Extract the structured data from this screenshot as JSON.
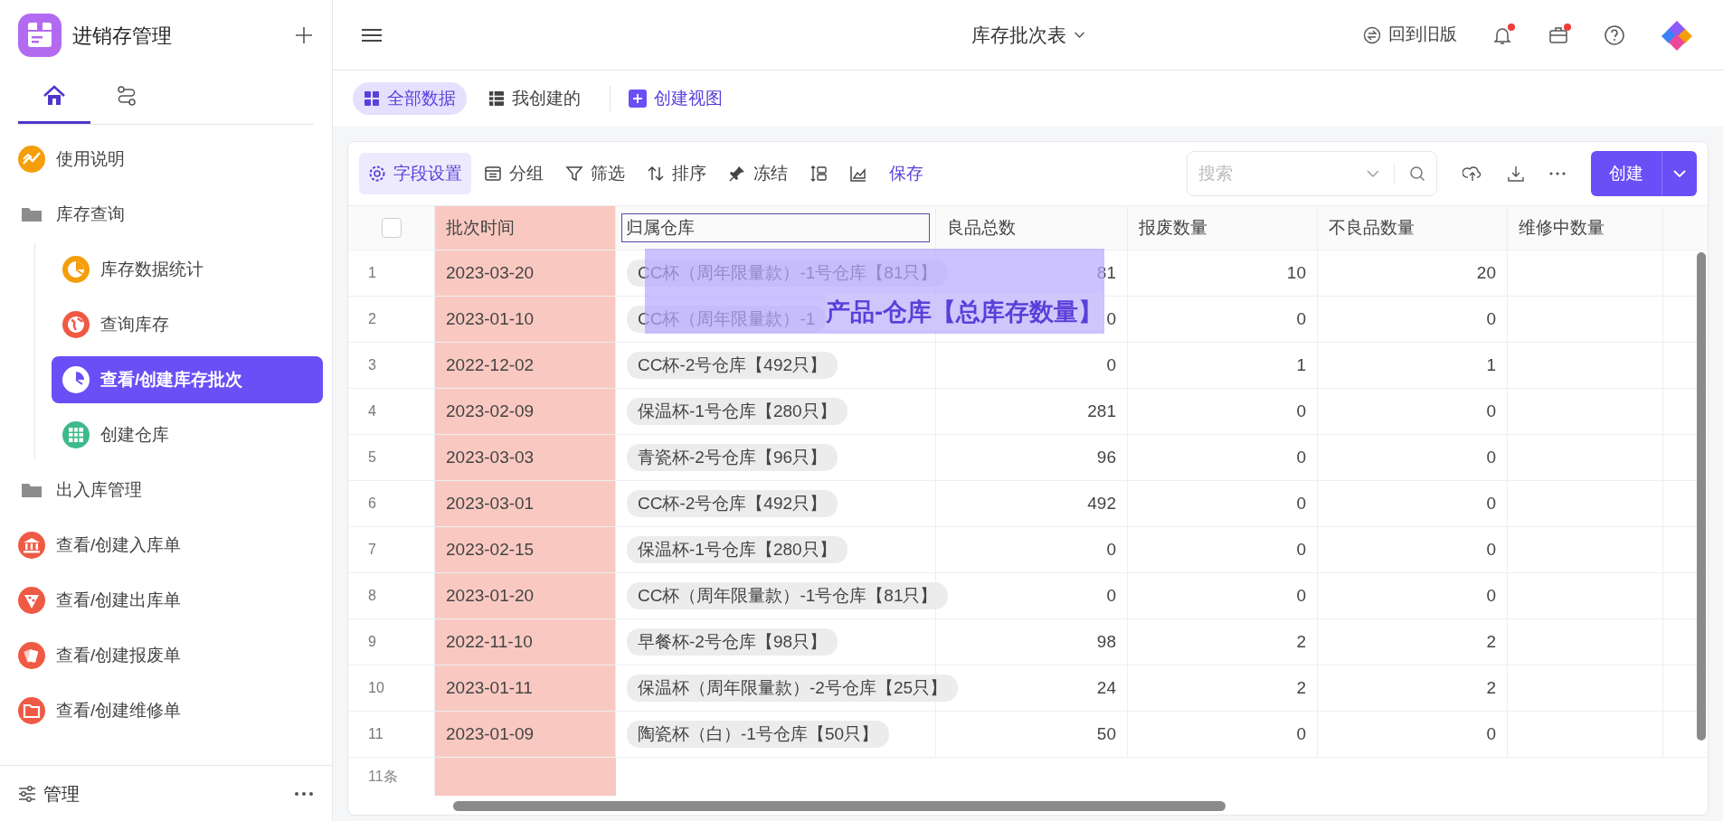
{
  "sidebar": {
    "title": "进销存管理",
    "tabs": [
      {
        "kind": "home",
        "selected": true
      },
      {
        "kind": "flow",
        "selected": false
      }
    ],
    "items": [
      {
        "label": "使用说明",
        "kind": "chart",
        "color": "#f59e0b",
        "selected": false
      },
      {
        "label": "库存查询",
        "kind": "folder",
        "selected": false,
        "children": [
          {
            "label": "库存数据统计",
            "kind": "pie",
            "color": "#f59e0b",
            "selected": false
          },
          {
            "label": "查询库存",
            "kind": "globe",
            "color": "#ef5a45",
            "selected": false
          },
          {
            "label": "查看/创建库存批次",
            "kind": "pie",
            "color": "#ffffff",
            "selected": true
          },
          {
            "label": "创建仓库",
            "kind": "grid",
            "color": "#3dba8c",
            "selected": false
          }
        ]
      },
      {
        "label": "出入库管理",
        "kind": "folder",
        "selected": false
      },
      {
        "label": "查看/创建入库单",
        "kind": "bank",
        "color": "#ef5a45",
        "selected": false
      },
      {
        "label": "查看/创建出库单",
        "kind": "pizza",
        "color": "#ef5a45",
        "selected": false
      },
      {
        "label": "查看/创建报废单",
        "kind": "cards",
        "color": "#ef5a45",
        "selected": false
      },
      {
        "label": "查看/创建维修单",
        "kind": "folder2",
        "color": "#ef5a45",
        "selected": false
      }
    ],
    "footer": "管理"
  },
  "header": {
    "title": "库存批次表",
    "old_version": "回到旧版",
    "bell_dot": true,
    "box_dot": true
  },
  "views": [
    {
      "label": "全部数据",
      "kind": "grid",
      "selected": true
    },
    {
      "label": "我创建的",
      "kind": "list",
      "selected": false
    }
  ],
  "create_view": "创建视图",
  "toolbar": [
    {
      "label": "字段设置",
      "kind": "gear",
      "selected": true
    },
    {
      "label": "分组",
      "kind": "group",
      "selected": false
    },
    {
      "label": "筛选",
      "kind": "filter",
      "selected": false
    },
    {
      "label": "排序",
      "kind": "sort",
      "selected": false
    },
    {
      "label": "冻结",
      "kind": "pin",
      "selected": false
    },
    {
      "kind": "rowheight",
      "selected": false
    },
    {
      "kind": "chart",
      "selected": false
    }
  ],
  "save": "保存",
  "search": {
    "placeholder": "搜索"
  },
  "create": "创建",
  "table": {
    "select_all": {
      "checked": false
    },
    "columns": [
      {
        "label": "批次时间",
        "highlighted": true,
        "selected": false
      },
      {
        "label": "归属仓库",
        "highlighted": false,
        "selected": true
      },
      {
        "label": "良品总数",
        "highlighted": false,
        "selected": false
      },
      {
        "label": "报废数量",
        "highlighted": false,
        "selected": false
      },
      {
        "label": "不良品数量",
        "highlighted": false,
        "selected": false
      },
      {
        "label": "维修中数量",
        "highlighted": false,
        "selected": false
      }
    ],
    "rows": [
      {
        "index": "1",
        "cells": [
          "2023-03-20",
          "CC杯（周年限量款）-1号仓库【81只】",
          "81",
          "10",
          "20"
        ]
      },
      {
        "index": "2",
        "cells": [
          "2023-01-10",
          "CC杯（周年限量款）-1",
          "0",
          "0",
          "0"
        ]
      },
      {
        "index": "3",
        "cells": [
          "2022-12-02",
          "CC杯-2号仓库【492只】",
          "0",
          "1",
          "1"
        ]
      },
      {
        "index": "4",
        "cells": [
          "2023-02-09",
          "保温杯-1号仓库【280只】",
          "281",
          "0",
          "0"
        ]
      },
      {
        "index": "5",
        "cells": [
          "2023-03-03",
          "青瓷杯-2号仓库【96只】",
          "96",
          "0",
          "0"
        ]
      },
      {
        "index": "6",
        "cells": [
          "2023-03-01",
          "CC杯-2号仓库【492只】",
          "492",
          "0",
          "0"
        ]
      },
      {
        "index": "7",
        "cells": [
          "2023-02-15",
          "保温杯-1号仓库【280只】",
          "0",
          "0",
          "0"
        ]
      },
      {
        "index": "8",
        "cells": [
          "2023-01-20",
          "CC杯（周年限量款）-1号仓库【81只】",
          "0",
          "0",
          "0"
        ]
      },
      {
        "index": "9",
        "cells": [
          "2022-11-10",
          "早餐杯-2号仓库【98只】",
          "98",
          "2",
          "2"
        ]
      },
      {
        "index": "10",
        "cells": [
          "2023-01-11",
          "保温杯（周年限量款）-2号仓库【25只】",
          "24",
          "2",
          "2"
        ]
      },
      {
        "index": "11",
        "cells": [
          "2023-01-09",
          "陶瓷杯（白）-1号仓库【50只】",
          "50",
          "0",
          "0"
        ]
      }
    ],
    "count": "11条"
  },
  "overlay": {
    "label": "产品-仓库【总库存数量】"
  }
}
